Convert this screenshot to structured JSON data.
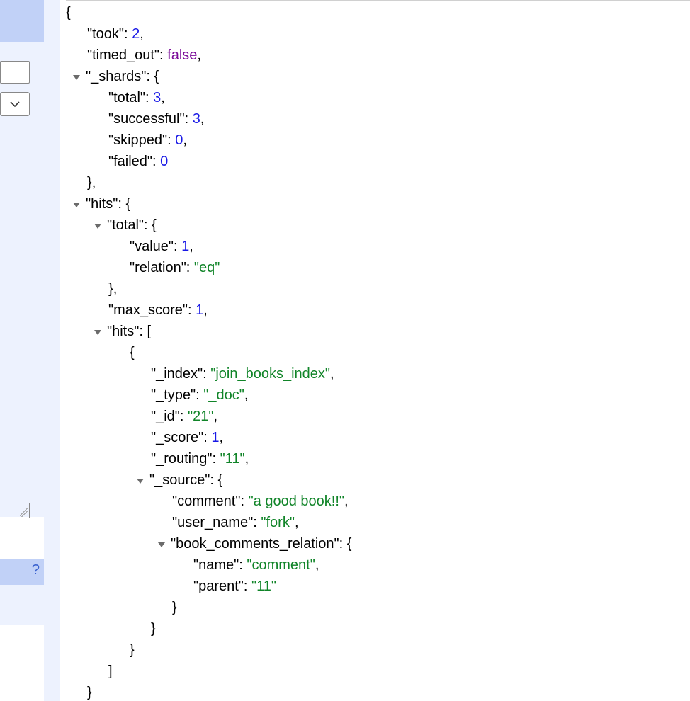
{
  "help_icon_label": "?",
  "json": {
    "brace_open": "{",
    "brace_close": "}",
    "bracket_open": "[",
    "bracket_close": "]",
    "comma": ",",
    "colon_sp": ": ",
    "took_key": "\"took\"",
    "took_val": "2",
    "timed_out_key": "\"timed_out\"",
    "timed_out_val": "false",
    "shards_key": "\"_shards\"",
    "shards_total_key": "\"total\"",
    "shards_total_val": "3",
    "shards_successful_key": "\"successful\"",
    "shards_successful_val": "3",
    "shards_skipped_key": "\"skipped\"",
    "shards_skipped_val": "0",
    "shards_failed_key": "\"failed\"",
    "shards_failed_val": "0",
    "hits_key": "\"hits\"",
    "hits_total_key": "\"total\"",
    "hits_total_value_key": "\"value\"",
    "hits_total_value_val": "1",
    "hits_total_relation_key": "\"relation\"",
    "hits_total_relation_val": "\"eq\"",
    "max_score_key": "\"max_score\"",
    "max_score_val": "1",
    "hits_arr_key": "\"hits\"",
    "idx_key": "\"_index\"",
    "idx_val": "\"join_books_index\"",
    "type_key": "\"_type\"",
    "type_val": "\"_doc\"",
    "id_key": "\"_id\"",
    "id_val": "\"21\"",
    "score_key": "\"_score\"",
    "score_val": "1",
    "routing_key": "\"_routing\"",
    "routing_val": "\"11\"",
    "source_key": "\"_source\"",
    "comment_key": "\"comment\"",
    "comment_val": "\"a good book!!\"",
    "user_name_key": "\"user_name\"",
    "user_name_val": "\"fork\"",
    "rel_key": "\"book_comments_relation\"",
    "rel_name_key": "\"name\"",
    "rel_name_val": "\"comment\"",
    "rel_parent_key": "\"parent\"",
    "rel_parent_val": "\"11\""
  }
}
